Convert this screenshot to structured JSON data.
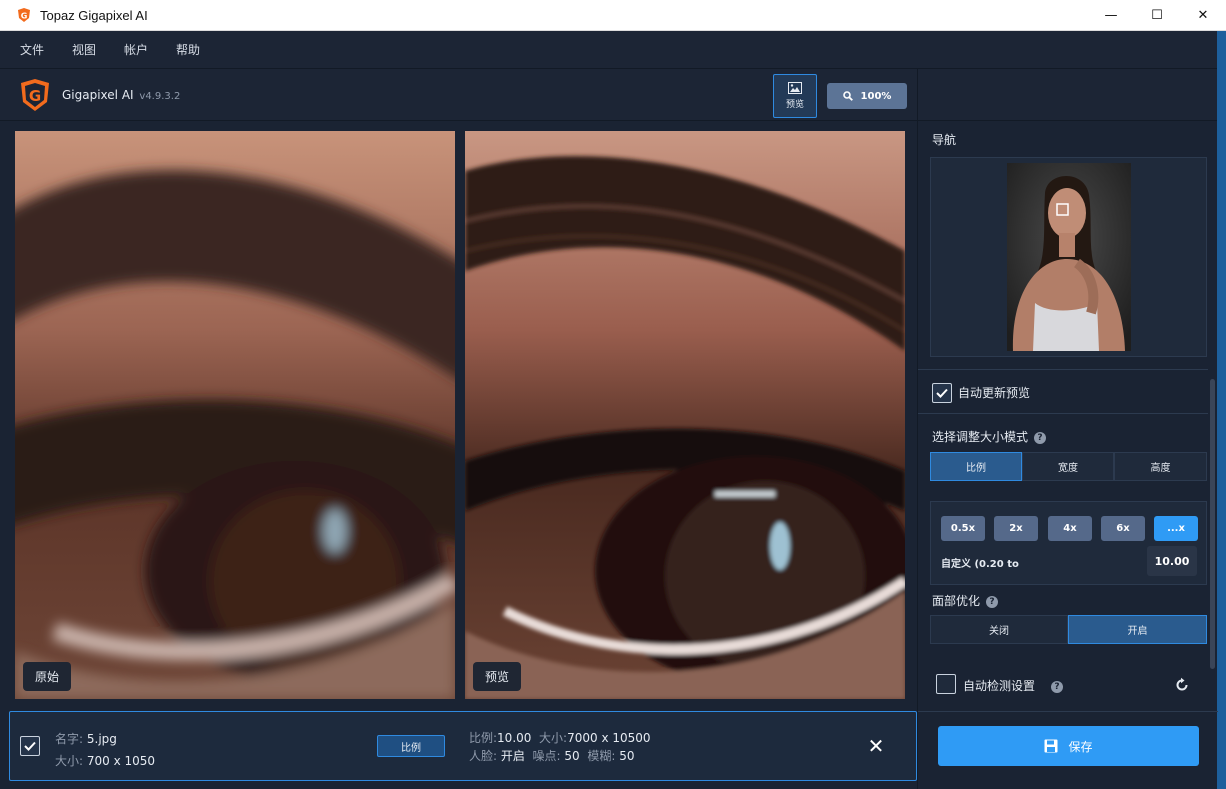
{
  "window": {
    "title": "Topaz Gigapixel AI",
    "minimize_glyph": "—",
    "maximize_glyph": "☐",
    "close_glyph": "✕"
  },
  "menu": {
    "items": [
      "文件",
      "视图",
      "帐户",
      "帮助"
    ]
  },
  "header": {
    "app_name": "Gigapixel AI",
    "version": "v4.9.3.2",
    "preview_label": "预览",
    "zoom_label": "100%"
  },
  "panels": {
    "left_label": "原始",
    "right_label": "预览"
  },
  "file_bar": {
    "name_label": "名字:",
    "name_value": "5.jpg",
    "size_label": "大小:",
    "size_value": "700 x 1050",
    "mode_label": "比例",
    "scale_label": "比例:",
    "scale_value": "10.00",
    "out_size_label": "大小:",
    "out_size_value": "7000 x 10500",
    "face_label": "人脸:",
    "face_value": "开启",
    "noise_label": "噪点:",
    "noise_value": "50",
    "blur_label": "模糊:",
    "blur_value": "50",
    "checked": true
  },
  "sidebar": {
    "nav_title": "导航",
    "auto_update_label": "自动更新预览",
    "auto_update_checked": true,
    "resize_mode_title": "选择调整大小模式",
    "resize_modes": [
      "比例",
      "宽度",
      "高度"
    ],
    "resize_mode_selected": "比例",
    "scale_options": [
      "0.5x",
      "2x",
      "4x",
      "6x",
      "...x"
    ],
    "scale_selected": "...x",
    "custom_label": "自定义 (0.20 to",
    "custom_value": "10.00",
    "face_title": "面部优化",
    "face_options": [
      "关闭",
      "开启"
    ],
    "face_selected": "开启",
    "auto_detect_label": "自动检测设置",
    "auto_detect_checked": false,
    "save_label": "保存"
  },
  "colors": {
    "accent": "#2f9bf5",
    "panel_bg": "#1a2333",
    "brand_orange": "#f26b1d"
  }
}
